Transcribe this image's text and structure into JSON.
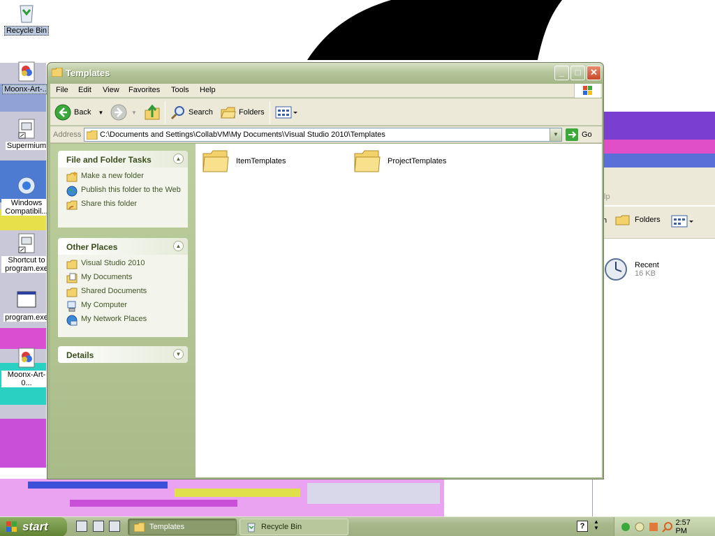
{
  "desktop": {
    "icons": [
      {
        "label": "Recycle Bin",
        "icon": "recycle-bin-icon",
        "selected": true
      },
      {
        "label": "Moonx-Art-...",
        "icon": "image-file-icon",
        "selected": true
      },
      {
        "label": "Supermium",
        "icon": "shortcut-icon",
        "selected": false
      },
      {
        "label": "Windows Compatibil...",
        "icon": "compatibility-icon",
        "selected": false
      },
      {
        "label": "Shortcut to program.exe",
        "icon": "shortcut-icon",
        "selected": false
      },
      {
        "label": "program.exe",
        "icon": "program-icon",
        "selected": false
      },
      {
        "label": "Moonx-Art-0...",
        "icon": "image-file-icon",
        "selected": false
      }
    ]
  },
  "background_window": {
    "partial_menu_text": "lp",
    "toolbar_partial": "h",
    "folders_label": "Folders",
    "item": {
      "name": "Recent",
      "size": "16 KB"
    }
  },
  "window": {
    "title": "Templates",
    "menu": [
      "File",
      "Edit",
      "View",
      "Favorites",
      "Tools",
      "Help"
    ],
    "toolbar": {
      "back_label": "Back",
      "search_label": "Search",
      "folders_label": "Folders"
    },
    "address": {
      "label": "Address",
      "path": "C:\\Documents and Settings\\CollabVM\\My Documents\\Visual Studio 2010\\Templates",
      "go_label": "Go"
    },
    "tasks_panel": {
      "title": "File and Folder Tasks",
      "items": [
        "Make a new folder",
        "Publish this folder to the Web",
        "Share this folder"
      ]
    },
    "places_panel": {
      "title": "Other Places",
      "items": [
        "Visual Studio 2010",
        "My Documents",
        "Shared Documents",
        "My Computer",
        "My Network Places"
      ]
    },
    "details_panel": {
      "title": "Details"
    },
    "files": [
      {
        "name": "ItemTemplates",
        "type": "folder"
      },
      {
        "name": "ProjectTemplates",
        "type": "folder"
      }
    ]
  },
  "taskbar": {
    "start_label": "start",
    "tasks": [
      {
        "label": "Templates",
        "active": true
      },
      {
        "label": "Recycle Bin",
        "active": false
      }
    ],
    "clock": "2:57 PM"
  },
  "colors": {
    "title_bar": "#b4c59a",
    "left_pane": "#bccf9e",
    "panel_title_text": "#3a4d1c"
  }
}
